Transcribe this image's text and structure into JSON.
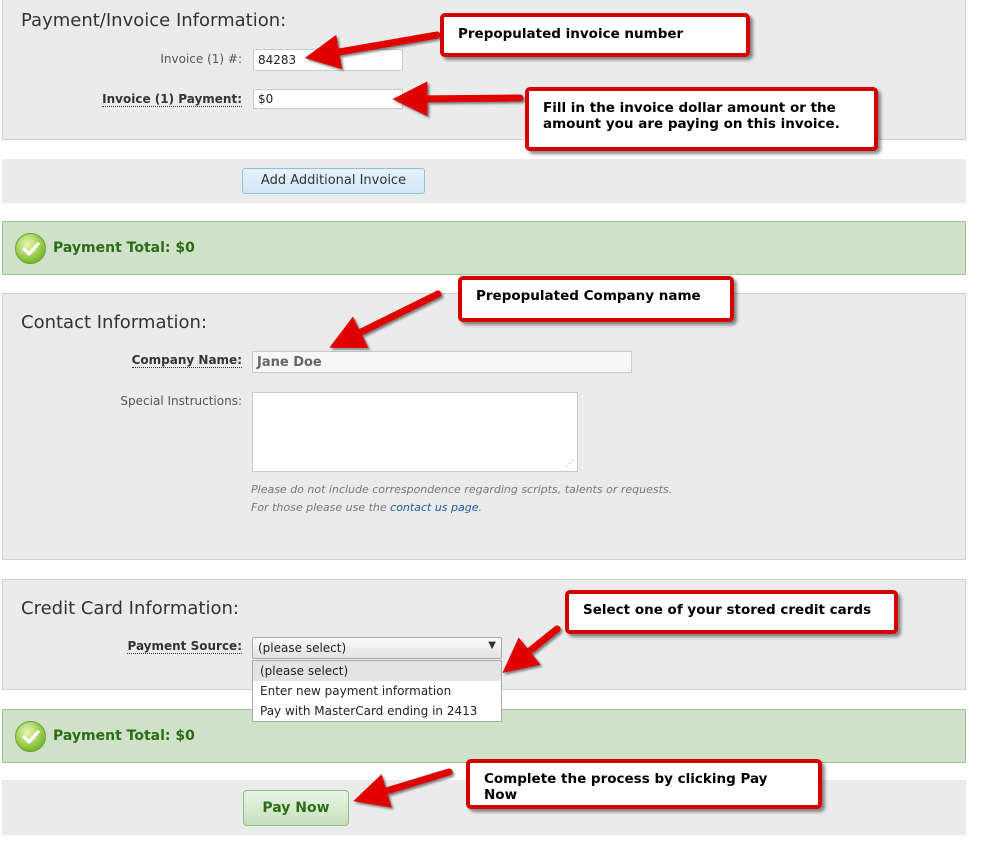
{
  "invoice_section": {
    "title": "Payment/Invoice Information:",
    "invoice_number_label": "Invoice (1) #:",
    "invoice_number_value": "84283",
    "invoice_payment_label": "Invoice (1) Payment:",
    "invoice_payment_value": "$0"
  },
  "add_invoice_button": "Add Additional Invoice",
  "payment_total_top": "Payment Total: $0",
  "contact_section": {
    "title": "Contact Information:",
    "company_label": "Company Name:",
    "company_value": "Jane Doe",
    "special_label": "Special Instructions:",
    "special_value": "",
    "hint_line1": "Please do not include correspondence regarding scripts, talents or requests.",
    "hint_line2_prefix": "For those please use the ",
    "hint_link": "contact us page",
    "hint_line2_suffix": "."
  },
  "credit_section": {
    "title": "Credit Card Information:",
    "source_label": "Payment Source:",
    "selected_value": "(please select)",
    "options": [
      "(please select)",
      "Enter new payment information",
      "Pay with MasterCard ending in 2413"
    ]
  },
  "payment_total_bottom": "Payment Total: $0",
  "pay_now_button": "Pay Now",
  "callouts": {
    "invoice_number": "Prepopulated invoice number",
    "invoice_amount": "Fill in the invoice dollar amount or the amount you are paying on this invoice.",
    "company_name": "Prepopulated Company name",
    "credit_cards": "Select one of your stored credit cards",
    "pay_now": "Complete the process by clicking Pay Now"
  },
  "colors": {
    "callout_border": "#d40000",
    "panel_bg": "#ebebeb",
    "total_bg": "#cfe1c9",
    "total_text": "#2c6d17",
    "link": "#1a5c9e"
  },
  "icons": [
    "check-circle-icon",
    "chevron-down-icon",
    "resize-handle-icon",
    "red-arrow-icon"
  ]
}
